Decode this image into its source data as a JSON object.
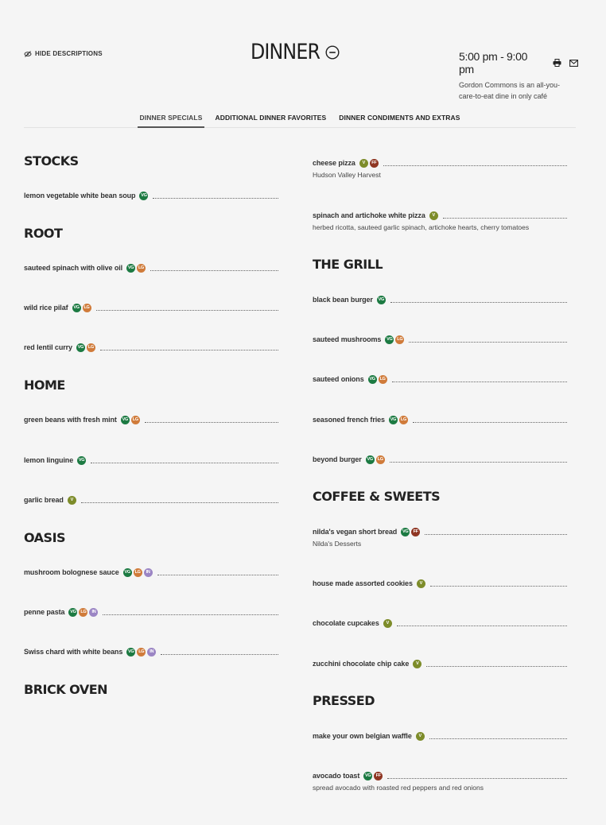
{
  "header": {
    "hide_descriptions_label": "HIDE DESCRIPTIONS",
    "title": "DINNER",
    "hours": "5:00 pm - 9:00 pm",
    "description": "Gordon Commons is an all-you-care-to-eat dine in only café"
  },
  "tabs": [
    {
      "label": "DINNER SPECIALS",
      "active": true
    },
    {
      "label": "ADDITIONAL DINNER FAVORITES",
      "active": false
    },
    {
      "label": "DINNER CONDIMENTS AND EXTRAS",
      "active": false
    }
  ],
  "badge_colors": {
    "VG": "#1c7a42",
    "LG": "#d07b3a",
    "V": "#7d8c2a",
    "FF": "#8f3623",
    "IN": "#9b85c4"
  },
  "left_column": [
    {
      "title": "STOCKS",
      "items": [
        {
          "name": "lemon vegetable white bean soup",
          "badges": [
            "VG"
          ]
        }
      ]
    },
    {
      "title": "ROOT",
      "items": [
        {
          "name": "sauteed spinach with olive oil",
          "badges": [
            "VG",
            "LG"
          ]
        },
        {
          "name": "wild rice pilaf",
          "badges": [
            "VG",
            "LG"
          ]
        },
        {
          "name": "red lentil curry",
          "badges": [
            "VG",
            "LG"
          ]
        }
      ]
    },
    {
      "title": "HOME",
      "items": [
        {
          "name": "green beans with fresh mint",
          "badges": [
            "VG",
            "LG"
          ]
        },
        {
          "name": "lemon linguine",
          "badges": [
            "VG"
          ]
        },
        {
          "name": "garlic bread",
          "badges": [
            "V"
          ]
        }
      ]
    },
    {
      "title": "OASIS",
      "items": [
        {
          "name": "mushroom bolognese sauce",
          "badges": [
            "VG",
            "LG",
            "IN"
          ]
        },
        {
          "name": "penne pasta",
          "badges": [
            "VG",
            "LG",
            "IN"
          ]
        },
        {
          "name": "Swiss chard with white beans",
          "badges": [
            "VG",
            "LG",
            "IN"
          ]
        }
      ]
    },
    {
      "title": "BRICK OVEN",
      "items": []
    }
  ],
  "right_column": [
    {
      "title": "",
      "items": [
        {
          "name": "cheese pizza",
          "badges": [
            "V",
            "FF"
          ],
          "desc": "Hudson Valley Harvest"
        },
        {
          "name": "spinach and artichoke white pizza",
          "badges": [
            "V"
          ],
          "desc": "herbed ricotta, sauteed garlic spinach, artichoke hearts, cherry tomatoes"
        }
      ]
    },
    {
      "title": "THE GRILL",
      "items": [
        {
          "name": "black bean burger",
          "badges": [
            "VG"
          ]
        },
        {
          "name": "sauteed mushrooms",
          "badges": [
            "VG",
            "LG"
          ]
        },
        {
          "name": "sauteed onions",
          "badges": [
            "VG",
            "LG"
          ]
        },
        {
          "name": "seasoned french fries",
          "badges": [
            "VG",
            "LG"
          ]
        },
        {
          "name": "beyond burger",
          "badges": [
            "VG",
            "LG"
          ]
        }
      ]
    },
    {
      "title": "COFFEE & SWEETS",
      "items": [
        {
          "name": "nilda's vegan short bread",
          "badges": [
            "VG",
            "FF"
          ],
          "desc": "Nilda's Desserts"
        },
        {
          "name": "house made assorted cookies",
          "badges": [
            "V"
          ]
        },
        {
          "name": "chocolate cupcakes",
          "badges": [
            "V"
          ]
        },
        {
          "name": "zucchini chocolate chip cake",
          "badges": [
            "V"
          ]
        }
      ]
    },
    {
      "title": "PRESSED",
      "items": [
        {
          "name": "make your own belgian waffle",
          "badges": [
            "V"
          ]
        },
        {
          "name": "avocado toast",
          "badges": [
            "VG",
            "FF"
          ],
          "desc": "spread avocado with roasted red peppers and red onions"
        }
      ]
    }
  ]
}
